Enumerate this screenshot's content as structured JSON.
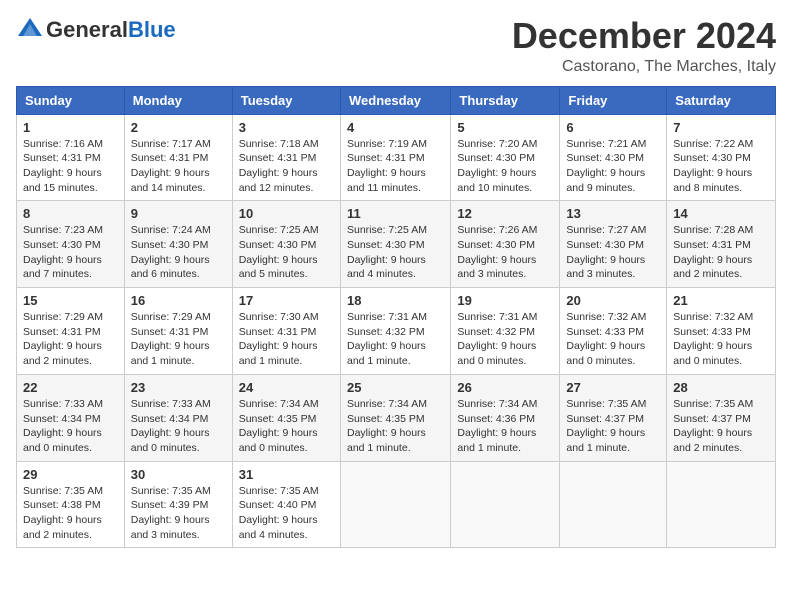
{
  "header": {
    "logo_general": "General",
    "logo_blue": "Blue",
    "month_title": "December 2024",
    "location": "Castorano, The Marches, Italy"
  },
  "days_of_week": [
    "Sunday",
    "Monday",
    "Tuesday",
    "Wednesday",
    "Thursday",
    "Friday",
    "Saturday"
  ],
  "weeks": [
    [
      {
        "day": "1",
        "info": "Sunrise: 7:16 AM\nSunset: 4:31 PM\nDaylight: 9 hours\nand 15 minutes."
      },
      {
        "day": "2",
        "info": "Sunrise: 7:17 AM\nSunset: 4:31 PM\nDaylight: 9 hours\nand 14 minutes."
      },
      {
        "day": "3",
        "info": "Sunrise: 7:18 AM\nSunset: 4:31 PM\nDaylight: 9 hours\nand 12 minutes."
      },
      {
        "day": "4",
        "info": "Sunrise: 7:19 AM\nSunset: 4:31 PM\nDaylight: 9 hours\nand 11 minutes."
      },
      {
        "day": "5",
        "info": "Sunrise: 7:20 AM\nSunset: 4:30 PM\nDaylight: 9 hours\nand 10 minutes."
      },
      {
        "day": "6",
        "info": "Sunrise: 7:21 AM\nSunset: 4:30 PM\nDaylight: 9 hours\nand 9 minutes."
      },
      {
        "day": "7",
        "info": "Sunrise: 7:22 AM\nSunset: 4:30 PM\nDaylight: 9 hours\nand 8 minutes."
      }
    ],
    [
      {
        "day": "8",
        "info": "Sunrise: 7:23 AM\nSunset: 4:30 PM\nDaylight: 9 hours\nand 7 minutes."
      },
      {
        "day": "9",
        "info": "Sunrise: 7:24 AM\nSunset: 4:30 PM\nDaylight: 9 hours\nand 6 minutes."
      },
      {
        "day": "10",
        "info": "Sunrise: 7:25 AM\nSunset: 4:30 PM\nDaylight: 9 hours\nand 5 minutes."
      },
      {
        "day": "11",
        "info": "Sunrise: 7:25 AM\nSunset: 4:30 PM\nDaylight: 9 hours\nand 4 minutes."
      },
      {
        "day": "12",
        "info": "Sunrise: 7:26 AM\nSunset: 4:30 PM\nDaylight: 9 hours\nand 3 minutes."
      },
      {
        "day": "13",
        "info": "Sunrise: 7:27 AM\nSunset: 4:30 PM\nDaylight: 9 hours\nand 3 minutes."
      },
      {
        "day": "14",
        "info": "Sunrise: 7:28 AM\nSunset: 4:31 PM\nDaylight: 9 hours\nand 2 minutes."
      }
    ],
    [
      {
        "day": "15",
        "info": "Sunrise: 7:29 AM\nSunset: 4:31 PM\nDaylight: 9 hours\nand 2 minutes."
      },
      {
        "day": "16",
        "info": "Sunrise: 7:29 AM\nSunset: 4:31 PM\nDaylight: 9 hours\nand 1 minute."
      },
      {
        "day": "17",
        "info": "Sunrise: 7:30 AM\nSunset: 4:31 PM\nDaylight: 9 hours\nand 1 minute."
      },
      {
        "day": "18",
        "info": "Sunrise: 7:31 AM\nSunset: 4:32 PM\nDaylight: 9 hours\nand 1 minute."
      },
      {
        "day": "19",
        "info": "Sunrise: 7:31 AM\nSunset: 4:32 PM\nDaylight: 9 hours\nand 0 minutes."
      },
      {
        "day": "20",
        "info": "Sunrise: 7:32 AM\nSunset: 4:33 PM\nDaylight: 9 hours\nand 0 minutes."
      },
      {
        "day": "21",
        "info": "Sunrise: 7:32 AM\nSunset: 4:33 PM\nDaylight: 9 hours\nand 0 minutes."
      }
    ],
    [
      {
        "day": "22",
        "info": "Sunrise: 7:33 AM\nSunset: 4:34 PM\nDaylight: 9 hours\nand 0 minutes."
      },
      {
        "day": "23",
        "info": "Sunrise: 7:33 AM\nSunset: 4:34 PM\nDaylight: 9 hours\nand 0 minutes."
      },
      {
        "day": "24",
        "info": "Sunrise: 7:34 AM\nSunset: 4:35 PM\nDaylight: 9 hours\nand 0 minutes."
      },
      {
        "day": "25",
        "info": "Sunrise: 7:34 AM\nSunset: 4:35 PM\nDaylight: 9 hours\nand 1 minute."
      },
      {
        "day": "26",
        "info": "Sunrise: 7:34 AM\nSunset: 4:36 PM\nDaylight: 9 hours\nand 1 minute."
      },
      {
        "day": "27",
        "info": "Sunrise: 7:35 AM\nSunset: 4:37 PM\nDaylight: 9 hours\nand 1 minute."
      },
      {
        "day": "28",
        "info": "Sunrise: 7:35 AM\nSunset: 4:37 PM\nDaylight: 9 hours\nand 2 minutes."
      }
    ],
    [
      {
        "day": "29",
        "info": "Sunrise: 7:35 AM\nSunset: 4:38 PM\nDaylight: 9 hours\nand 2 minutes."
      },
      {
        "day": "30",
        "info": "Sunrise: 7:35 AM\nSunset: 4:39 PM\nDaylight: 9 hours\nand 3 minutes."
      },
      {
        "day": "31",
        "info": "Sunrise: 7:35 AM\nSunset: 4:40 PM\nDaylight: 9 hours\nand 4 minutes."
      },
      {
        "day": "",
        "info": ""
      },
      {
        "day": "",
        "info": ""
      },
      {
        "day": "",
        "info": ""
      },
      {
        "day": "",
        "info": ""
      }
    ]
  ]
}
